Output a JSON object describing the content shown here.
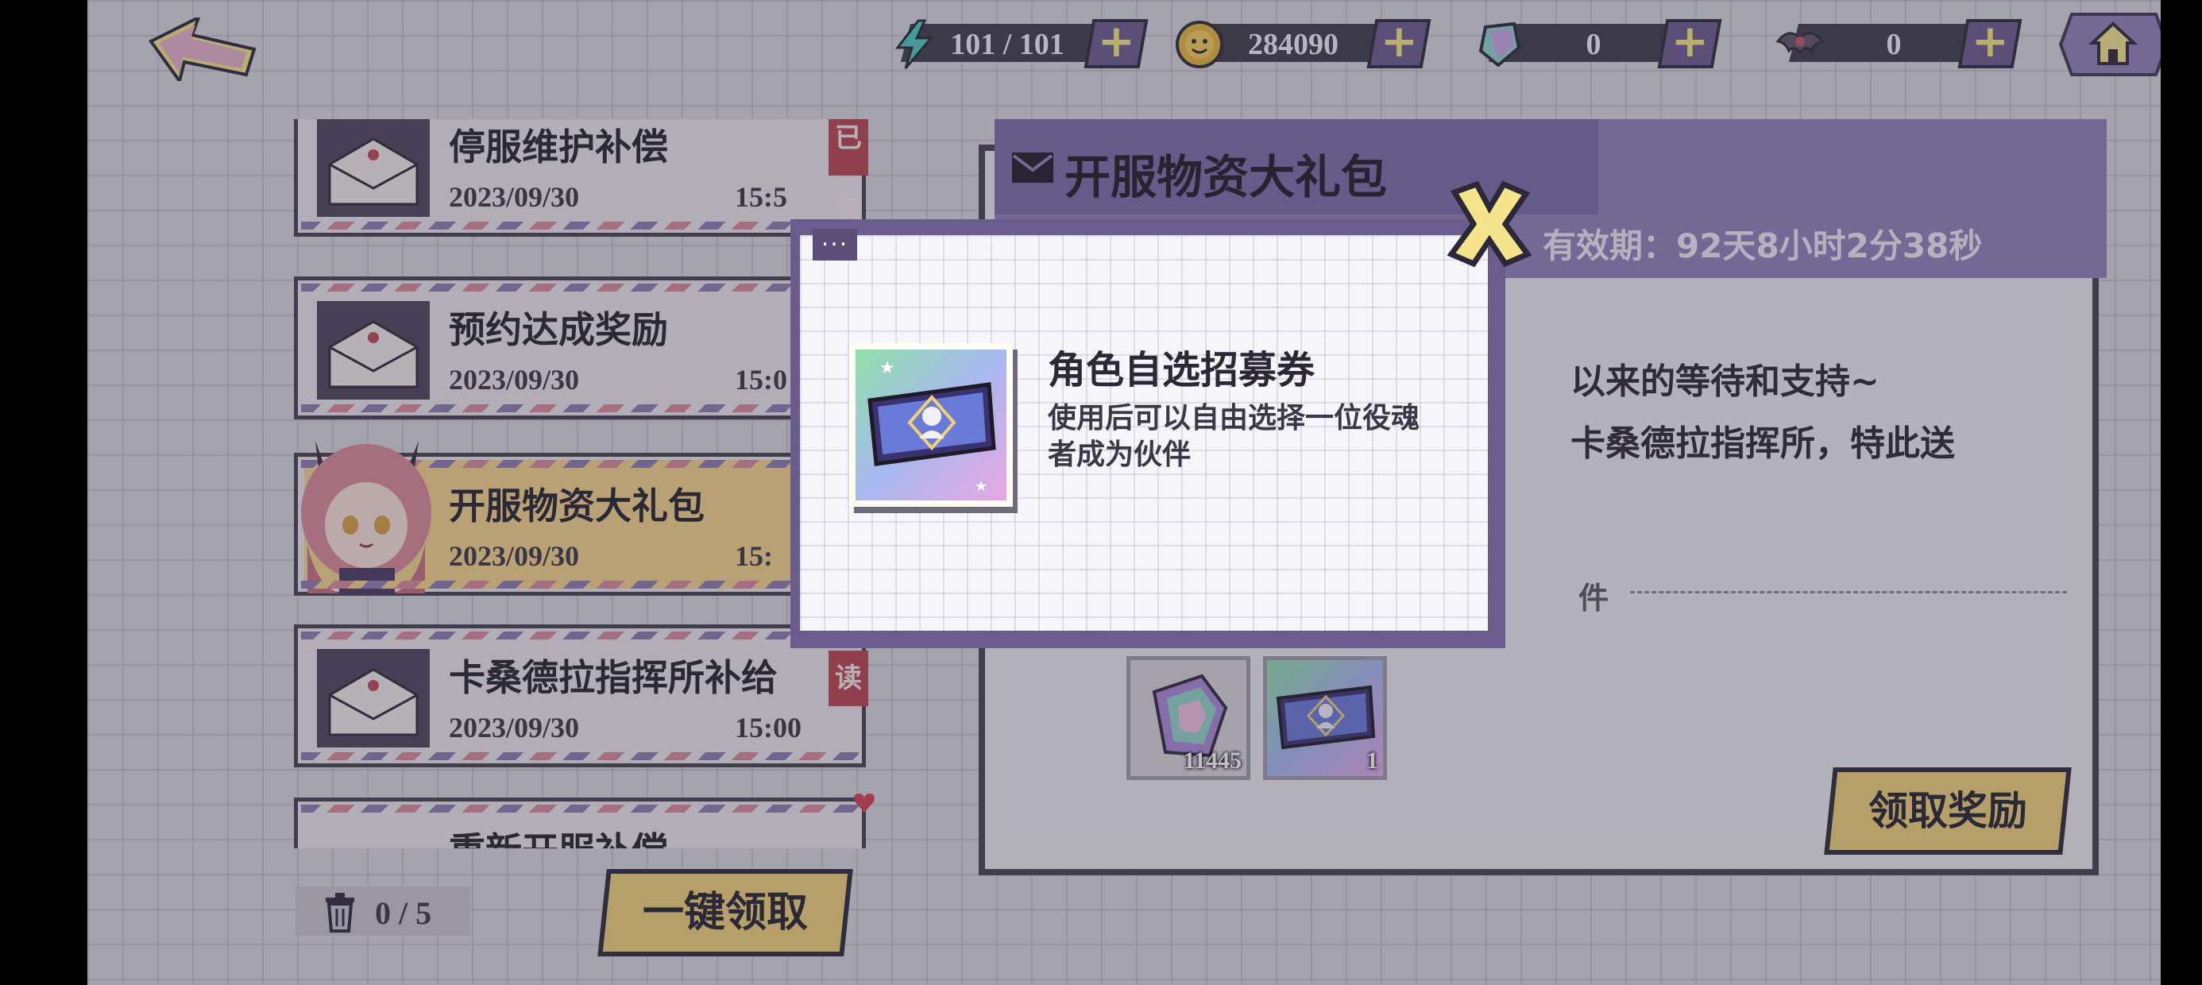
{
  "resources": {
    "stamina": "101 / 101",
    "coins": "284090",
    "gems": "0",
    "bats": "0"
  },
  "mail_list": {
    "items": [
      {
        "title": "停服维护补偿",
        "date": "2023/09/30",
        "time": "15:5",
        "read_tag": "已读"
      },
      {
        "title": "预约达成奖励",
        "date": "2023/09/30",
        "time": "15:0",
        "read_tag": ""
      },
      {
        "title": "开服物资大礼包",
        "date": "2023/09/30",
        "time": "15:",
        "read_tag": ""
      },
      {
        "title": "卡桑德拉指挥所补给",
        "date": "2023/09/30",
        "time": "15:00",
        "read_tag": "读"
      },
      {
        "title": "重新开服补偿",
        "date": "",
        "time": "",
        "read_tag": ""
      }
    ],
    "delete_count": "0 / 5",
    "claim_all_label": "一键领取"
  },
  "detail": {
    "title": "开服物资大礼包",
    "expiry": "有效期：92天8小时2分38秒",
    "body_line1": "以来的等待和支持~",
    "body_line2": "卡桑德拉指挥所，特此送",
    "attach_label": "件",
    "rewards": [
      {
        "icon": "crystal-icon",
        "count": "11445"
      },
      {
        "icon": "ticket-icon",
        "count": "1"
      }
    ],
    "claim_label": "领取奖励"
  },
  "popup": {
    "dots": "...",
    "item_name": "角色自选招募券",
    "item_desc": "使用后可以自由选择一位役魂者成为伙伴"
  },
  "colors": {
    "accent_purple": "#7b6aa6",
    "button_yellow": "#f0d27a",
    "dark": "#2c2838"
  }
}
